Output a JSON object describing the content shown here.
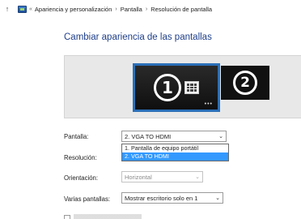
{
  "breadcrumb": {
    "lead": "«",
    "items": [
      "Apariencia y personalización",
      "Pantalla",
      "Resolución de pantalla"
    ],
    "separator": "›"
  },
  "page_title": "Cambiar apariencia de las pantallas",
  "monitors": [
    {
      "number": "1",
      "selected": true
    },
    {
      "number": "2",
      "selected": false
    }
  ],
  "form": {
    "pantalla": {
      "label": "Pantalla:",
      "value": "2. VGA TO HDMI",
      "options": [
        "1. Pantalla de equipo portátil",
        "2. VGA TO HDMI"
      ],
      "selected_index": 1
    },
    "resolucion": {
      "label": "Resolución:"
    },
    "orientacion": {
      "label": "Orientación:",
      "value": "Horizontal"
    },
    "varias": {
      "label": "Varias pantallas:",
      "value": "Mostrar escritorio solo en 1"
    }
  },
  "colors": {
    "title": "#1f3f8a",
    "selection": "#3399ff",
    "monitor_border": "#2b6fb8"
  }
}
